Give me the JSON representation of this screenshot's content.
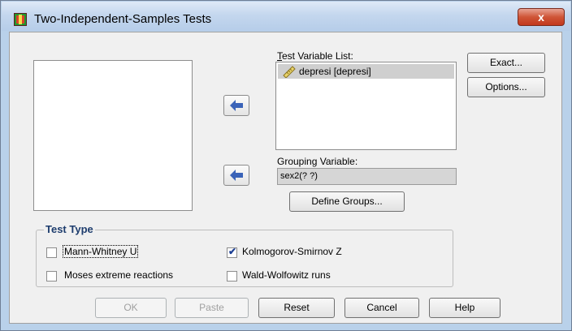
{
  "window": {
    "title": "Two-Independent-Samples Tests",
    "close_label": "x"
  },
  "test_variable_list": {
    "label": "Test Variable List:",
    "items": [
      "depresi [depresi]"
    ]
  },
  "grouping_variable": {
    "label": "Grouping Variable:",
    "value": "sex2(? ?)"
  },
  "side_buttons": {
    "exact": "Exact...",
    "options": "Options..."
  },
  "define_groups_label": "Define Groups...",
  "test_type": {
    "title": "Test Type",
    "options": [
      {
        "label": "Mann-Whitney U",
        "checked": false
      },
      {
        "label": "Moses extreme reactions",
        "checked": false
      },
      {
        "label": "Kolmogorov-Smirnov Z",
        "checked": true
      },
      {
        "label": "Wald-Wolfowitz runs",
        "checked": false
      }
    ]
  },
  "bottom_buttons": {
    "ok": "OK",
    "paste": "Paste",
    "reset": "Reset",
    "cancel": "Cancel",
    "help": "Help"
  },
  "colors": {
    "title_bar": "#c4d7ee",
    "close_button": "#cf5537",
    "arrow": "#3a63b8",
    "group_title": "#1e3d6e"
  }
}
